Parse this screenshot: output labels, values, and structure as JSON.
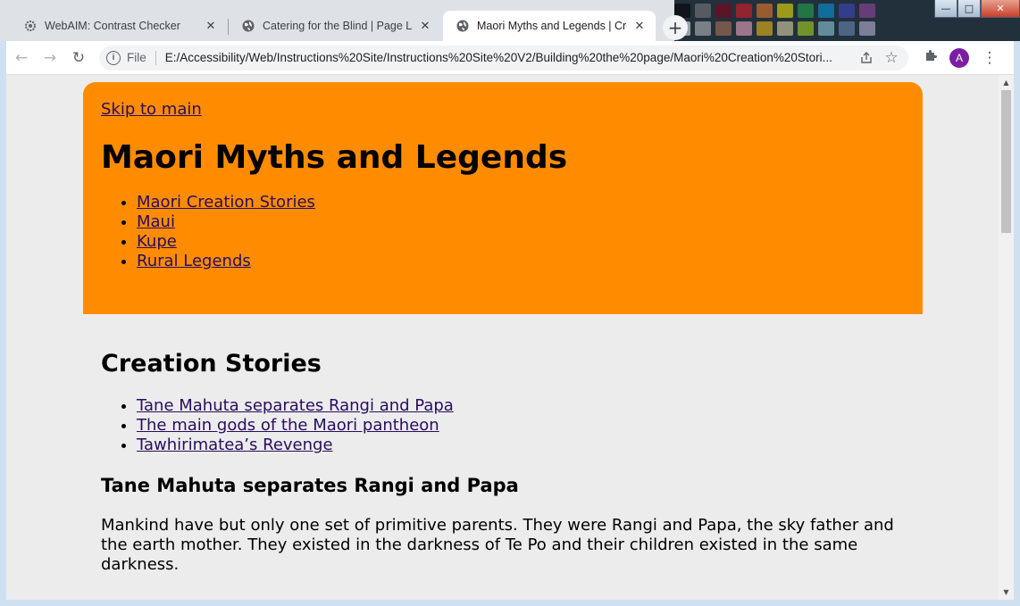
{
  "window_controls": {
    "minimize": "—",
    "maximize": "□",
    "close": "✕"
  },
  "tabs": [
    {
      "title": "WebAIM: Contrast Checker",
      "icon": "gear-favicon-icon",
      "close": "✕"
    },
    {
      "title": "Catering for the Blind | Page Layout",
      "icon": "globe-icon",
      "close": "✕"
    },
    {
      "title": "Maori Myths and Legends | Creation",
      "icon": "globe-icon",
      "close": "✕",
      "active": true
    }
  ],
  "new_tab": "+",
  "toolbar": {
    "back": "←",
    "forward": "→",
    "reload": "↻",
    "scheme": "File",
    "url": "E:/Accessibility/Web/Instructions%20Site/Instructions%20Site%20V2/Building%20the%20page/Maori%20Creation%20Stori...",
    "share_icon": "share-icon",
    "bookmark": "☆",
    "extensions_icon": "puzzle-icon",
    "avatar_initial": "A",
    "menu": "⋮"
  },
  "page": {
    "skip_link": "Skip to main",
    "site_title": "Maori Myths and Legends",
    "nav": [
      "Maori Creation Stories",
      "Maui",
      "Kupe",
      "Rural Legends"
    ],
    "section_title": "Creation Stories",
    "toc": [
      "Tane Mahuta separates Rangi and Papa",
      "The main gods of the Maori pantheon",
      "Tawhirimatea’s Revenge"
    ],
    "subheading": "Tane Mahuta separates Rangi and Papa",
    "paragraph": "Mankind have but only one set of primitive parents. They were Rangi and Papa, the sky father and the earth mother. They existed in the darkness of Te Po and their children existed in the same darkness."
  },
  "colors": {
    "header_bg": "#ff8c00",
    "page_bg": "#ececec",
    "link": "#2a0d5e"
  }
}
